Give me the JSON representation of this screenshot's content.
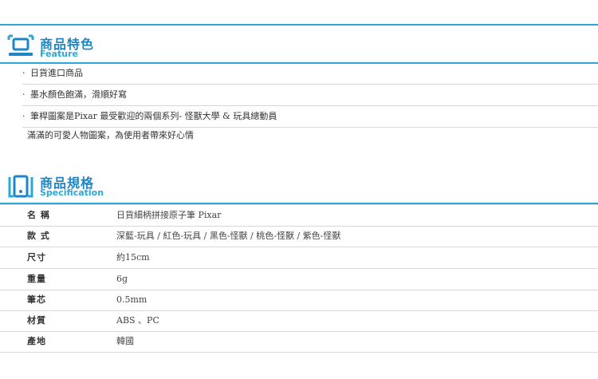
{
  "feature": {
    "title": "商品特色",
    "subtitle": "Feature",
    "items": [
      "日貨進口商品",
      "墨水顏色飽滿，滑順好寫",
      "筆桿圖案是Pixar 最受歡迎的兩個系列- 怪獸大學 & 玩具總動員"
    ],
    "note": "滿滿的可愛人物圖案，為使用者帶來好心情"
  },
  "spec": {
    "title": "商品規格",
    "subtitle": "Specification",
    "rows": [
      {
        "label": "名 稱",
        "value": "日貨細柄拼接原子筆 Pixar"
      },
      {
        "label": "款 式",
        "value": "深藍-玩具 / 紅色-玩具 / 黑色-怪獸 /  桃色-怪獸 / 紫色-怪獸"
      },
      {
        "label": "尺寸",
        "value": "約15cm"
      },
      {
        "label": "重量",
        "value": "6g"
      },
      {
        "label": "筆芯",
        "value": "0.5mm"
      },
      {
        "label": "材質",
        "value": "ABS 、PC"
      },
      {
        "label": "產地",
        "value": "韓國"
      }
    ]
  },
  "colors": {
    "accent": "#1f86c6",
    "accent_light": "#2aa8d8"
  },
  "icons": {
    "feature": "monitor-icon",
    "spec": "phone-frame-icon"
  }
}
